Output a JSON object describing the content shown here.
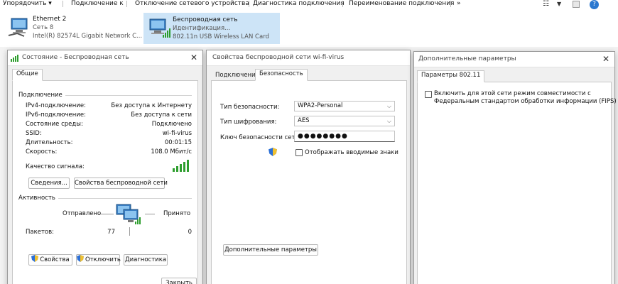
{
  "toolbar": {
    "organize": "Упорядочить ▾",
    "connect_to": "Подключение к",
    "disable": "Отключение сетевого устройства",
    "diagnose": "Диагностика подключения",
    "rename": "Переименование подключения",
    "more": "»"
  },
  "adapters": [
    {
      "name": "Ethernet 2",
      "line1": "Сеть 8",
      "line2": "Intel(R) 82574L Gigabit Network C..."
    },
    {
      "name": "Беспроводная сеть",
      "line1": "Идентификация...",
      "line2": "802.11n USB Wireless LAN Card"
    }
  ],
  "status_window": {
    "title": "Состояние - Беспроводная сеть",
    "tab": "Общие",
    "connection_group": "Подключение",
    "rows": [
      {
        "label": "IPv4-подключение:",
        "value": "Без доступа к Интернету"
      },
      {
        "label": "IPv6-подключение:",
        "value": "Без доступа к сети"
      },
      {
        "label": "Состояние среды:",
        "value": "Подключено"
      },
      {
        "label": "SSID:",
        "value": "wi-fi-virus"
      },
      {
        "label": "Длительность:",
        "value": "00:01:15"
      },
      {
        "label": "Скорость:",
        "value": "108.0 Мбит/с"
      }
    ],
    "signal_label": "Качество сигнала:",
    "details_btn": "Сведения...",
    "wireless_props_btn": "Свойства беспроводной сети",
    "activity_group": "Активность",
    "sent_label": "Отправлено",
    "received_label": "Принято",
    "packets_label": "Пакетов:",
    "packets_sent": "77",
    "packets_received": "0",
    "properties_btn": "Свойства",
    "disable_btn": "Отключить",
    "diagnose_btn": "Диагностика",
    "close_btn": "Закрыть"
  },
  "props_window": {
    "title": "Свойства беспроводной сети wi-fi-virus",
    "tab_connection": "Подключение",
    "tab_security": "Безопасность",
    "security_type_label": "Тип безопасности:",
    "security_type_value": "WPA2-Personal",
    "encryption_label": "Тип шифрования:",
    "encryption_value": "AES",
    "key_label": "Ключ безопасности сети",
    "key_value": "●●●●●●●●",
    "show_chars_label": "Отображать вводимые знаки",
    "advanced_btn": "Дополнительные параметры"
  },
  "advanced_window": {
    "title": "Дополнительные параметры",
    "tab": "Параметры 802.11",
    "fips_label_line1": "Включить для этой сети режим совместимости с",
    "fips_label_line2": "Федеральным стандартом обработки информации (FIPS)"
  },
  "colors": {
    "accent": "#0078d7",
    "signal_green": "#2e9e2e",
    "selection": "#cde4f7"
  }
}
